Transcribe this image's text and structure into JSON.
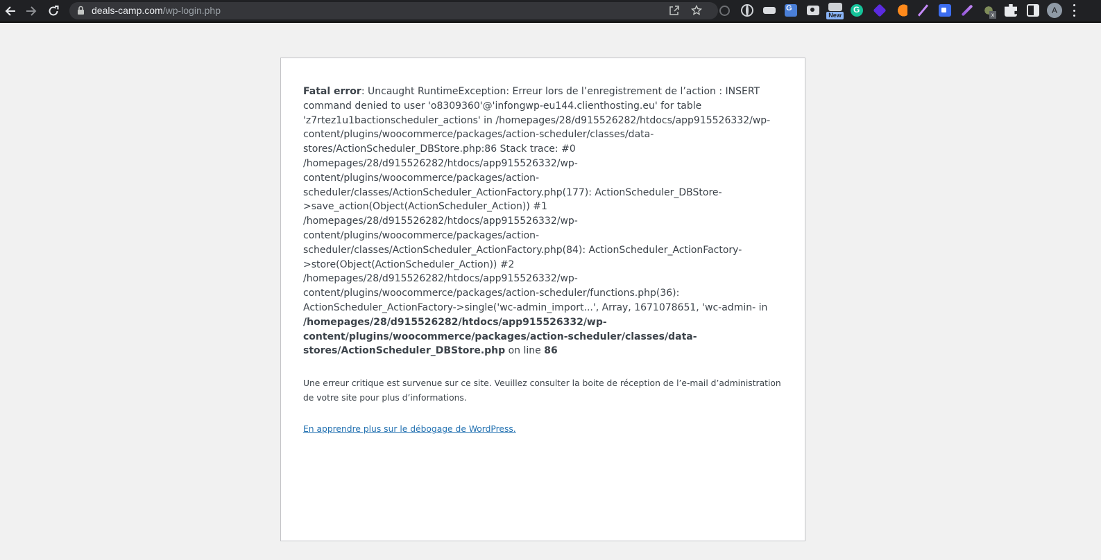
{
  "browser": {
    "url_host": "deals-camp.com",
    "url_path": "/wp-login.php",
    "extension_new_badge": "New",
    "extension_badge_x": "x",
    "avatar_letter": "A"
  },
  "error": {
    "fatal_label": "Fatal error",
    "message": ": Uncaught RuntimeException: Erreur lors de l’enregistrement de l’action : INSERT command denied to user 'o8309360'@'infongwp-eu144.clienthosting.eu' for table 'z7rtez1u1bactionscheduler_actions' in /homepages/28/d915526282/htdocs/app915526332/wp-content/plugins/woocommerce/packages/action-scheduler/classes/data-stores/ActionScheduler_DBStore.php:86 Stack trace: #0 /homepages/28/d915526282/htdocs/app915526332/wp-content/plugins/woocommerce/packages/action-scheduler/classes/ActionScheduler_ActionFactory.php(177): ActionScheduler_DBStore->save_action(Object(ActionScheduler_Action)) #1 /homepages/28/d915526282/htdocs/app915526332/wp-content/plugins/woocommerce/packages/action-scheduler/classes/ActionScheduler_ActionFactory.php(84): ActionScheduler_ActionFactory->store(Object(ActionScheduler_Action)) #2 /homepages/28/d915526282/htdocs/app915526332/wp-content/plugins/woocommerce/packages/action-scheduler/functions.php(36): ActionScheduler_ActionFactory->single('wc-admin_import...', Array, 1671078651, 'wc-admin- in ",
    "file_path": "/homepages/28/d915526282/htdocs/app915526332/wp-content/plugins/woocommerce/packages/action-scheduler/classes/data-stores/ActionScheduler_DBStore.php",
    "on_line_text": " on line ",
    "line_number": "86",
    "critical_message": "Une erreur critique est survenue sur ce site. Veuillez consulter la boite de réception de l’e-mail d’administration de votre site pour plus d’informations.",
    "learn_more_link": "En apprendre plus sur le débogage de WordPress."
  },
  "colors": {
    "page_background": "#f1f1f1",
    "card_background": "#ffffff",
    "link": "#2271b1",
    "text": "#3c434a"
  }
}
